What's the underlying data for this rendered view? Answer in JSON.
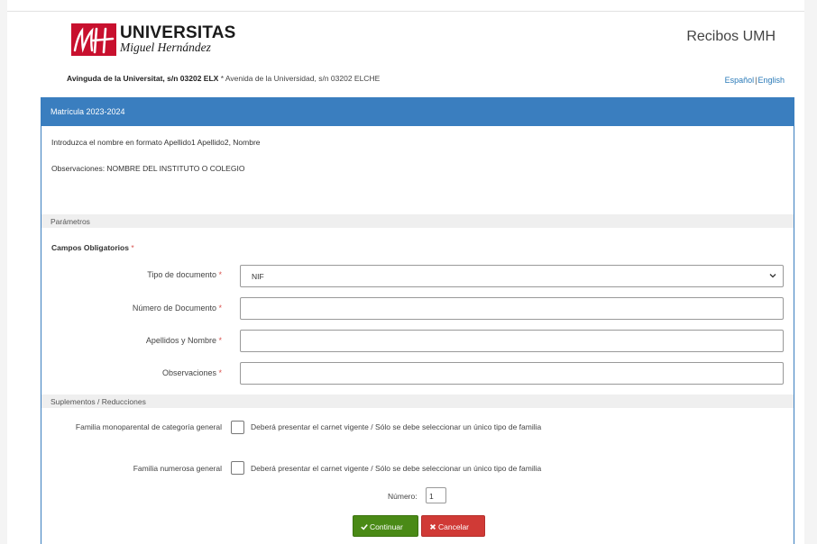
{
  "header": {
    "logo_word": "UNIVERSITAS",
    "logo_sub": "Miguel Hernández",
    "app_title": "Recibos UMH",
    "address_bold": "Avinguda de la Universitat, s/n 03202 ELX",
    "address_sep": " * ",
    "address_rest": "Avenida de la Universidad, s/n 03202 ELCHE",
    "lang_es": "Español",
    "lang_sep": "|",
    "lang_en": "English"
  },
  "panel": {
    "title": "Matrícula 2023-2024",
    "info_1": "Introduzca el nombre en formato Apellido1 Apellido2, Nombre",
    "info_2": "Observaciones: NOMBRE DEL INSTITUTO O COLEGIO"
  },
  "params": {
    "section_title": "Parámetros",
    "required_title": "Campos Obligatorios",
    "star": "*",
    "doc_type_label": "Tipo de documento",
    "doc_type_value": "NIF",
    "doc_number_label": "Número de Documento",
    "doc_number_value": "",
    "name_label": "Apellidos y Nombre",
    "name_value": "",
    "notes_label": "Observaciones",
    "notes_value": ""
  },
  "supplements": {
    "section_title": "Suplementos / Reducciones",
    "single_parent_label": "Familia monoparental de categoría general",
    "single_parent_note": "Deberá presentar el carnet vigente / Sólo se debe seleccionar un único tipo de familia",
    "large_family_label": "Familia numerosa general",
    "large_family_note": "Deberá presentar el carnet vigente / Sólo se debe seleccionar un único tipo de familia",
    "number_label": "Número:",
    "number_value": "1"
  },
  "actions": {
    "continue_label": "Continuar",
    "cancel_label": "Cancelar"
  },
  "colors": {
    "brand_red": "#c8102e",
    "panel_blue": "#3a7ebf",
    "continue_green": "#4a8a16",
    "cancel_red": "#d03a36",
    "link_blue": "#2a7ab8"
  },
  "icons": [
    "umh-logo-icon",
    "chevron-down-icon",
    "check-icon",
    "times-icon"
  ]
}
